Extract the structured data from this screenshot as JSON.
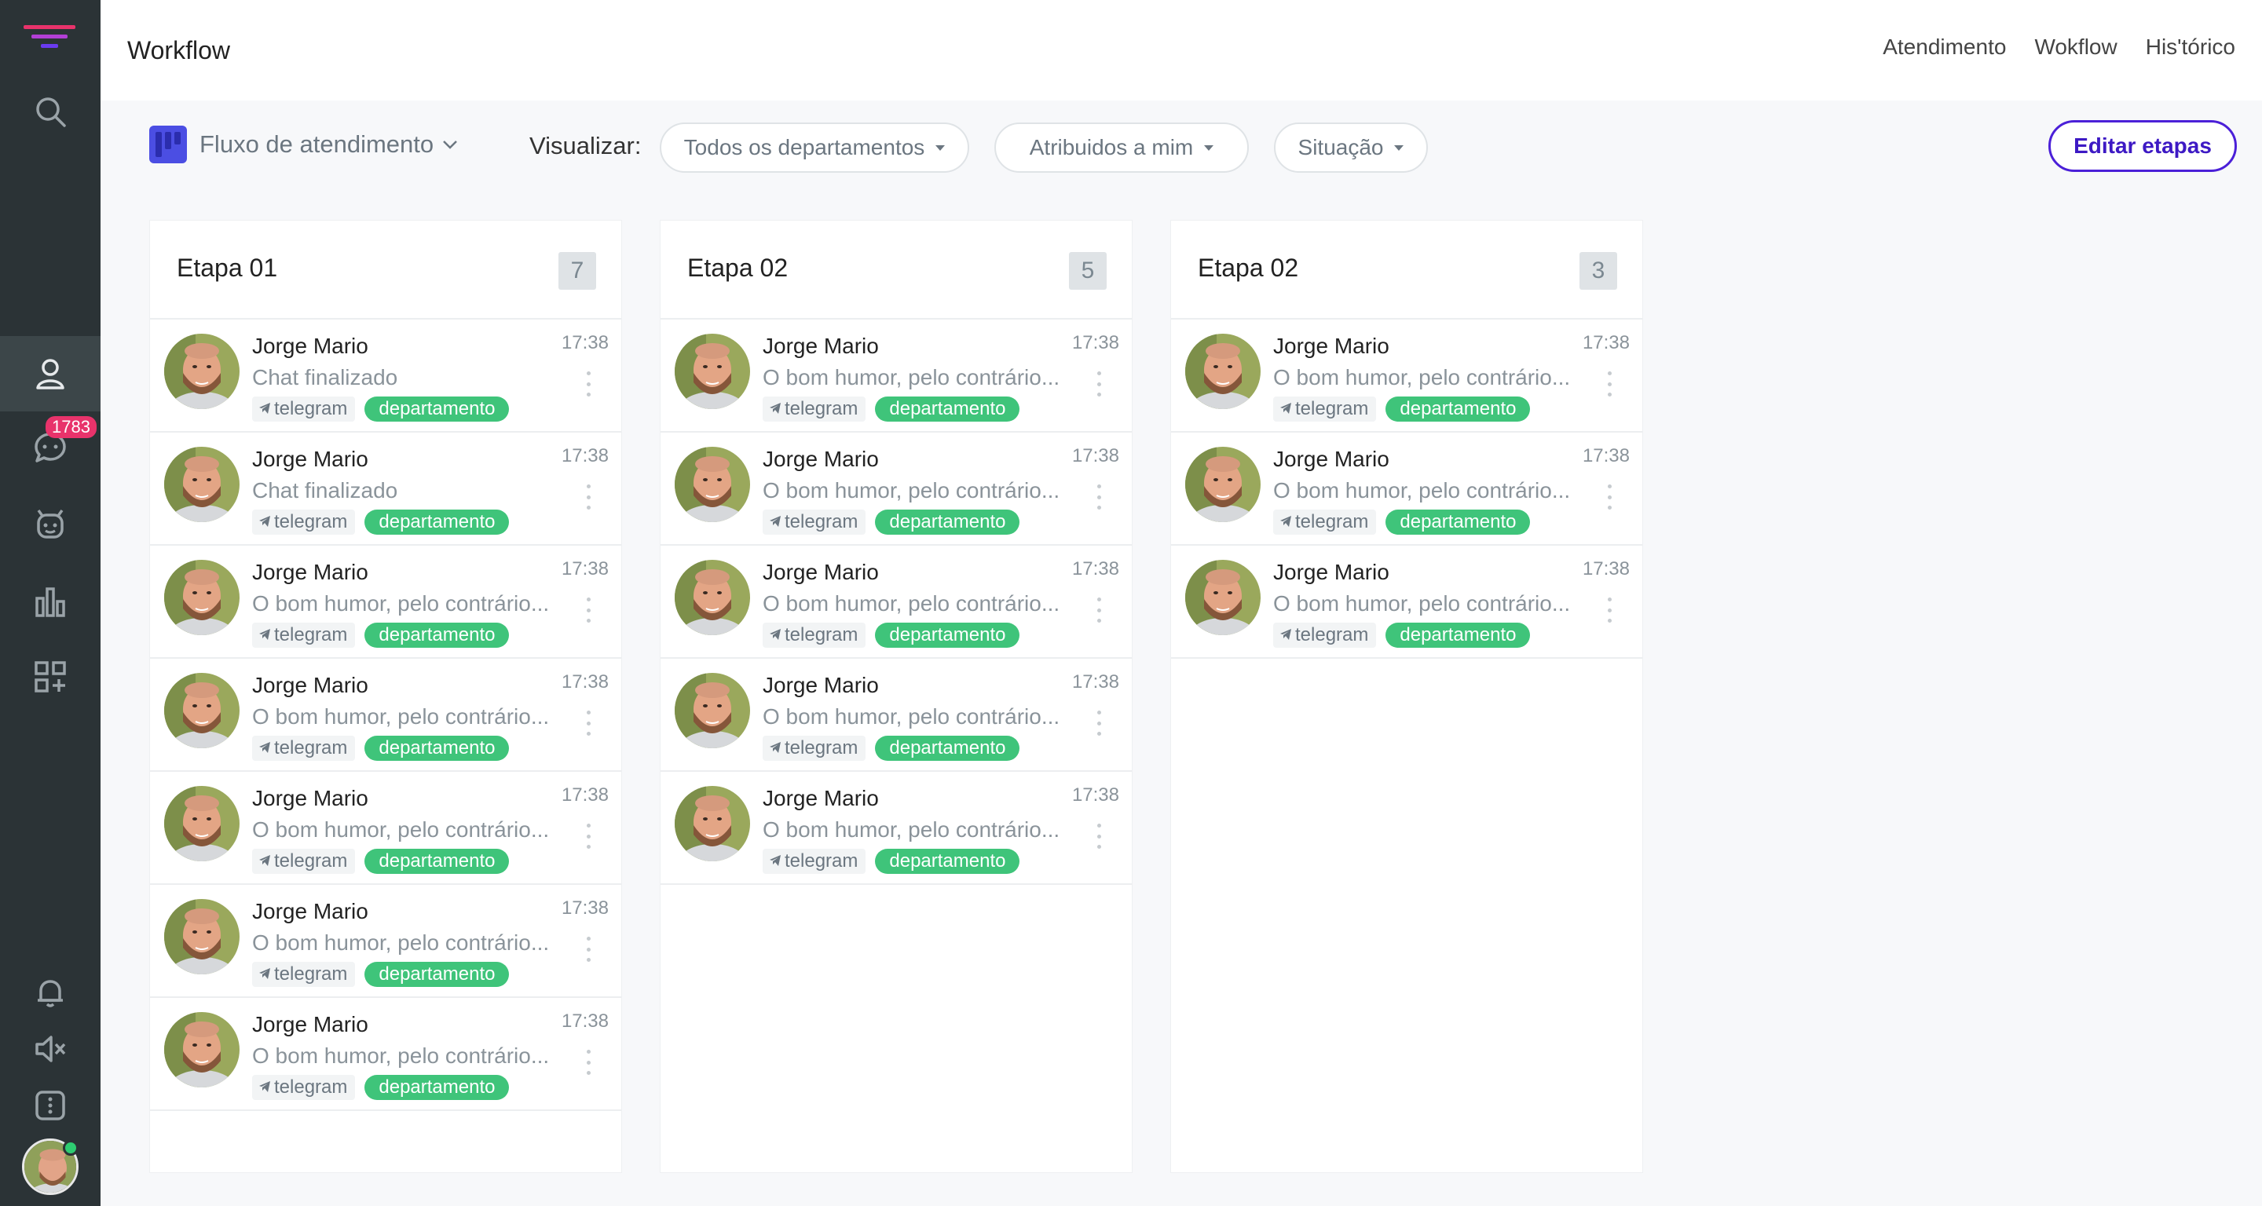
{
  "colors": {
    "sidebar": "#2b3336",
    "accent": "#4b20d8",
    "tag_green": "#3fc47a",
    "badge_pink": "#e8336b"
  },
  "sidebar": {
    "badge_count": "1783",
    "icons": [
      "search-icon",
      "contacts-icon",
      "chat-icon",
      "bot-icon",
      "chart-icon",
      "apps-add-icon",
      "bell-icon",
      "mute-icon",
      "more-icon"
    ]
  },
  "header": {
    "title": "Workflow",
    "nav": [
      "Atendimento",
      "Wokflow",
      "His'tórico"
    ]
  },
  "toolbar": {
    "flow_name": "Fluxo de atendimento",
    "view_label": "Visualizar:",
    "filters": [
      "Todos os departamentos",
      "Atribuidos a mim",
      "Situação"
    ],
    "edit_button": "Editar etapas"
  },
  "columns": [
    {
      "title": "Etapa 01",
      "count": "7",
      "cards": [
        {
          "name": "Jorge Mario",
          "time": "17:38",
          "message": "Chat finalizado",
          "channel": "telegram",
          "tag": "departamento"
        },
        {
          "name": "Jorge Mario",
          "time": "17:38",
          "message": "Chat finalizado",
          "channel": "telegram",
          "tag": "departamento"
        },
        {
          "name": "Jorge Mario",
          "time": "17:38",
          "message": "O bom humor, pelo contrário...",
          "channel": "telegram",
          "tag": "departamento"
        },
        {
          "name": "Jorge Mario",
          "time": "17:38",
          "message": "O bom humor, pelo contrário...",
          "channel": "telegram",
          "tag": "departamento"
        },
        {
          "name": "Jorge Mario",
          "time": "17:38",
          "message": "O bom humor, pelo contrário...",
          "channel": "telegram",
          "tag": "departamento"
        },
        {
          "name": "Jorge Mario",
          "time": "17:38",
          "message": "O bom humor, pelo contrário...",
          "channel": "telegram",
          "tag": "departamento"
        },
        {
          "name": "Jorge Mario",
          "time": "17:38",
          "message": "O bom humor, pelo contrário...",
          "channel": "telegram",
          "tag": "departamento"
        }
      ]
    },
    {
      "title": "Etapa 02",
      "count": "5",
      "cards": [
        {
          "name": "Jorge Mario",
          "time": "17:38",
          "message": "O bom humor, pelo contrário...",
          "channel": "telegram",
          "tag": "departamento"
        },
        {
          "name": "Jorge Mario",
          "time": "17:38",
          "message": "O bom humor, pelo contrário...",
          "channel": "telegram",
          "tag": "departamento"
        },
        {
          "name": "Jorge Mario",
          "time": "17:38",
          "message": "O bom humor, pelo contrário...",
          "channel": "telegram",
          "tag": "departamento"
        },
        {
          "name": "Jorge Mario",
          "time": "17:38",
          "message": "O bom humor, pelo contrário...",
          "channel": "telegram",
          "tag": "departamento"
        },
        {
          "name": "Jorge Mario",
          "time": "17:38",
          "message": "O bom humor, pelo contrário...",
          "channel": "telegram",
          "tag": "departamento"
        }
      ]
    },
    {
      "title": "Etapa 02",
      "count": "3",
      "cards": [
        {
          "name": "Jorge Mario",
          "time": "17:38",
          "message": "O bom humor, pelo contrário...",
          "channel": "telegram",
          "tag": "departamento"
        },
        {
          "name": "Jorge Mario",
          "time": "17:38",
          "message": "O bom humor, pelo contrário...",
          "channel": "telegram",
          "tag": "departamento"
        },
        {
          "name": "Jorge Mario",
          "time": "17:38",
          "message": "O bom humor, pelo contrário...",
          "channel": "telegram",
          "tag": "departamento"
        }
      ]
    }
  ]
}
